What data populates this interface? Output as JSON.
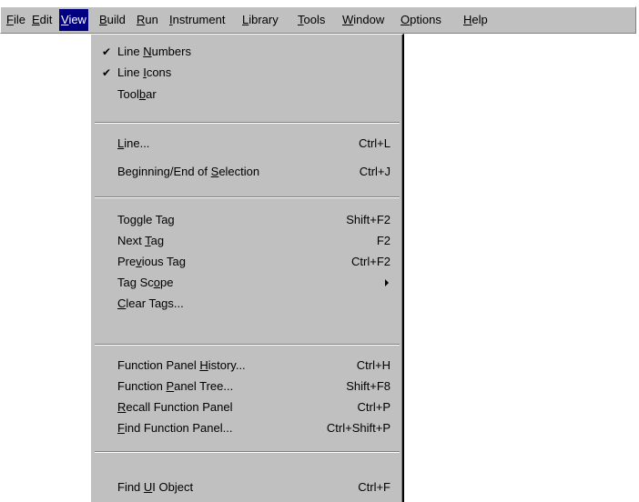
{
  "menubar": {
    "items": [
      {
        "pre": "",
        "u": "F",
        "post": "ile"
      },
      {
        "pre": "",
        "u": "E",
        "post": "dit"
      },
      {
        "pre": "",
        "u": "V",
        "post": "iew"
      },
      {
        "pre": "",
        "u": "B",
        "post": "uild"
      },
      {
        "pre": "",
        "u": "R",
        "post": "un"
      },
      {
        "pre": "",
        "u": "I",
        "post": "nstrument"
      },
      {
        "pre": "",
        "u": "L",
        "post": "ibrary"
      },
      {
        "pre": "",
        "u": "T",
        "post": "ools"
      },
      {
        "pre": "",
        "u": "W",
        "post": "indow"
      },
      {
        "pre": "",
        "u": "O",
        "post": "ptions"
      },
      {
        "pre": "",
        "u": "H",
        "post": "elp"
      }
    ]
  },
  "view_menu": {
    "items": [
      {
        "pre": "Line ",
        "u": "N",
        "post": "umbers",
        "checked": "✔",
        "shortcut": ""
      },
      {
        "pre": "Line ",
        "u": "I",
        "post": "cons",
        "checked": "✔",
        "shortcut": ""
      },
      {
        "pre": "Tool",
        "u": "b",
        "post": "ar",
        "checked": "",
        "shortcut": ""
      },
      {
        "pre": "",
        "u": "L",
        "post": "ine...",
        "checked": "",
        "shortcut": "Ctrl+L"
      },
      {
        "pre": "Beginning/End of ",
        "u": "S",
        "post": "election",
        "checked": "",
        "shortcut": "Ctrl+J"
      },
      {
        "pre": "To",
        "u": "g",
        "post": "gle Tag",
        "checked": "",
        "shortcut": "Shift+F2"
      },
      {
        "pre": "Next ",
        "u": "T",
        "post": "ag",
        "checked": "",
        "shortcut": "F2"
      },
      {
        "pre": "Pre",
        "u": "v",
        "post": "ious Tag",
        "checked": "",
        "shortcut": "Ctrl+F2"
      },
      {
        "pre": "Tag Sc",
        "u": "o",
        "post": "pe",
        "checked": "",
        "shortcut": ""
      },
      {
        "pre": "",
        "u": "C",
        "post": "lear Tags...",
        "checked": "",
        "shortcut": ""
      },
      {
        "pre": "Function Panel ",
        "u": "H",
        "post": "istory...",
        "checked": "",
        "shortcut": "Ctrl+H"
      },
      {
        "pre": "Function ",
        "u": "P",
        "post": "anel Tree...",
        "checked": "",
        "shortcut": "Shift+F8"
      },
      {
        "pre": "",
        "u": "R",
        "post": "ecall Function Panel",
        "checked": "",
        "shortcut": "Ctrl+P"
      },
      {
        "pre": "",
        "u": "F",
        "post": "ind Function Panel...",
        "checked": "",
        "shortcut": "Ctrl+Shift+P"
      },
      {
        "pre": "Find ",
        "u": "U",
        "post": "I Object",
        "checked": "",
        "shortcut": "Ctrl+F"
      }
    ]
  }
}
